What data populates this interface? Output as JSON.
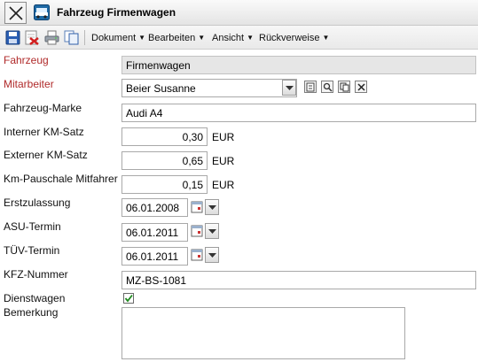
{
  "window": {
    "title": "Fahrzeug Firmenwagen"
  },
  "toolbar": {
    "menus": [
      "Dokument",
      "Bearbeiten",
      "Ansicht",
      "Rückverweise"
    ]
  },
  "form": {
    "fahrzeug": {
      "label": "Fahrzeug",
      "value": "Firmenwagen"
    },
    "mitarbeiter": {
      "label": "Mitarbeiter",
      "value": "Beier Susanne"
    },
    "marke": {
      "label": "Fahrzeug-Marke",
      "value": "Audi A4"
    },
    "km_intern": {
      "label": "Interner KM-Satz",
      "value": "0,30",
      "unit": "EUR"
    },
    "km_extern": {
      "label": "Externer KM-Satz",
      "value": "0,65",
      "unit": "EUR"
    },
    "km_pauschale": {
      "label": "Km-Pauschale Mitfahrer",
      "value": "0,15",
      "unit": "EUR"
    },
    "erstzulassung": {
      "label": "Erstzulassung",
      "value": "06.01.2008"
    },
    "asu": {
      "label": "ASU-Termin",
      "value": "06.01.2011"
    },
    "tuev": {
      "label": "TÜV-Termin",
      "value": "06.01.2011"
    },
    "kfz": {
      "label": "KFZ-Nummer",
      "value": "MZ-BS-1081"
    },
    "dienstwagen": {
      "label": "Dienstwagen",
      "checked": true
    },
    "bemerkung": {
      "label": "Bemerkung",
      "value": ""
    }
  },
  "colors": {
    "required_label": "#b02a2a",
    "readonly_bg": "#e6e6e6"
  },
  "icons": [
    "close-icon",
    "car-icon",
    "save-icon",
    "delete-icon",
    "print-icon",
    "copy-icon",
    "new-icon",
    "search-icon",
    "copy-record-icon",
    "clear-icon",
    "calendar-icon",
    "chevron-down-icon",
    "checkbox-checked-icon"
  ]
}
